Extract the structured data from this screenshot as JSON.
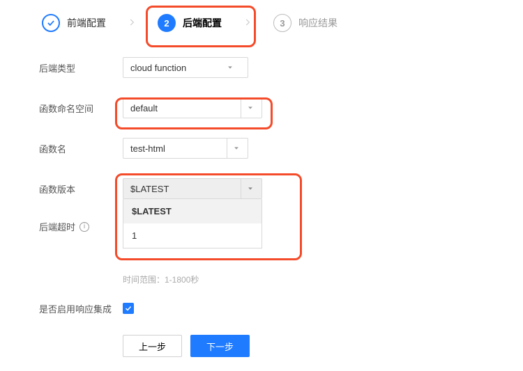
{
  "steps": {
    "s1": {
      "label": "前端配置"
    },
    "s2": {
      "num": "2",
      "label": "后端配置"
    },
    "s3": {
      "num": "3",
      "label": "响应结果"
    }
  },
  "labels": {
    "backendType": "后端类型",
    "namespace": "函数命名空间",
    "funcName": "函数名",
    "funcVersion": "函数版本",
    "timeout": "后端超时",
    "enableIntegration": "是否启用响应集成"
  },
  "values": {
    "backendType": "cloud function",
    "namespace": "default",
    "funcName": "test-html",
    "funcVersion": "$LATEST"
  },
  "versionOptions": {
    "o0": "$LATEST",
    "o1": "1"
  },
  "hints": {
    "timeoutRange": "时间范围：1-1800秒"
  },
  "buttons": {
    "prev": "上一步",
    "next": "下一步"
  },
  "icons": {
    "info": "i"
  }
}
